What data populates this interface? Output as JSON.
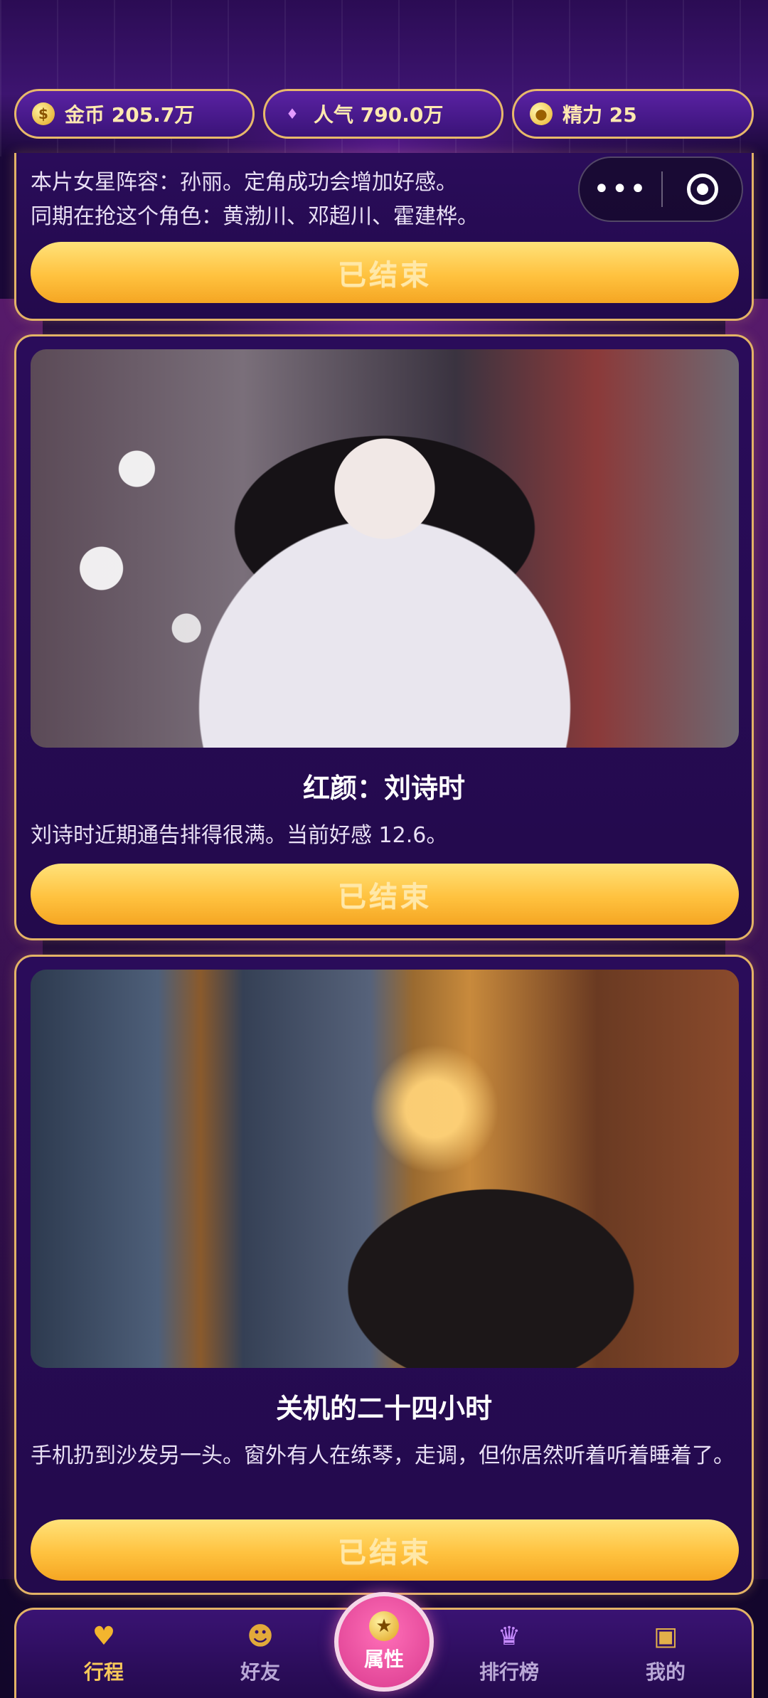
{
  "resources": {
    "gold": {
      "label": "金币 205.7万",
      "icon": "coin-icon"
    },
    "popularity": {
      "label": "人气 790.0万",
      "icon": "gem-icon"
    },
    "energy": {
      "label": "精力 25",
      "icon": "energy-icon"
    }
  },
  "capsule": {
    "more": "•••"
  },
  "cards": [
    {
      "line1": "本片女星阵容：孙丽。定角成功会增加好感。",
      "line2": "同期在抢这个角色：黄渤川、邓超川、霍建桦。",
      "button": "已结束"
    },
    {
      "title": "红颜：刘诗时",
      "desc": "刘诗时近期通告排得很满。当前好感 12.6。",
      "button": "已结束"
    },
    {
      "title": "关机的二十四小时",
      "desc": "手机扔到沙发另一头。窗外有人在练琴，走调，但你居然听着听着睡着了。",
      "button": "已结束"
    }
  ],
  "nav": {
    "items": [
      {
        "label": "行程",
        "icon": "heart-icon",
        "active": true
      },
      {
        "label": "好友",
        "icon": "friends-icon"
      },
      {
        "label": "属性",
        "icon": "star-coin-icon"
      },
      {
        "label": "排行榜",
        "icon": "trophy-icon"
      },
      {
        "label": "我的",
        "icon": "backpack-icon"
      }
    ]
  },
  "colors": {
    "accent_gold": "#e3b366",
    "button_yellow": "#ffc23f",
    "active_nav": "#f7c85a",
    "center_pink": "#d93a8e"
  }
}
